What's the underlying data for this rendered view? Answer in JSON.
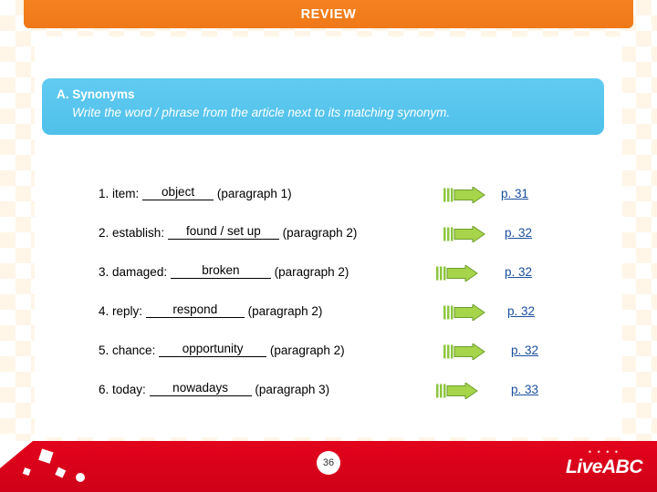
{
  "header": {
    "title": "REVIEW"
  },
  "panel": {
    "title": "A. Synonyms",
    "instruction": "Write the word / phrase from the article next to its matching synonym."
  },
  "questions": [
    {
      "number": "1.",
      "prompt": "item:",
      "answer": "object",
      "paragraph": "(paragraph 1)",
      "page_ref": "p. 31",
      "arrow_icon": "right-arrow-icon"
    },
    {
      "number": "2.",
      "prompt": "establish:",
      "answer": "found / set up",
      "paragraph": "(paragraph 2)",
      "page_ref": "p. 32",
      "arrow_icon": "right-arrow-icon"
    },
    {
      "number": "3.",
      "prompt": "damaged:",
      "answer": "broken",
      "paragraph": "(paragraph 2)",
      "page_ref": "p. 32",
      "arrow_icon": "right-arrow-icon"
    },
    {
      "number": "4.",
      "prompt": "reply:",
      "answer": "respond",
      "paragraph": "(paragraph 2)",
      "page_ref": "p. 32",
      "arrow_icon": "right-arrow-icon"
    },
    {
      "number": "5.",
      "prompt": "chance:",
      "answer": "opportunity",
      "paragraph": "(paragraph 2)",
      "page_ref": "p. 32",
      "arrow_icon": "right-arrow-icon"
    },
    {
      "number": "6.",
      "prompt": "today:",
      "answer": "nowadays",
      "paragraph": "(paragraph 3)",
      "page_ref": "p. 33",
      "arrow_icon": "right-arrow-icon"
    }
  ],
  "footer": {
    "page_number": "36",
    "logo_text": "LiveABC",
    "logo_dots": "• • • •"
  },
  "colors": {
    "header_orange": "#f47b20",
    "panel_blue": "#5ec8ef",
    "footer_red": "#e2001a",
    "link_blue": "#1b4fa0",
    "arrow_green": "#8dc63f"
  }
}
